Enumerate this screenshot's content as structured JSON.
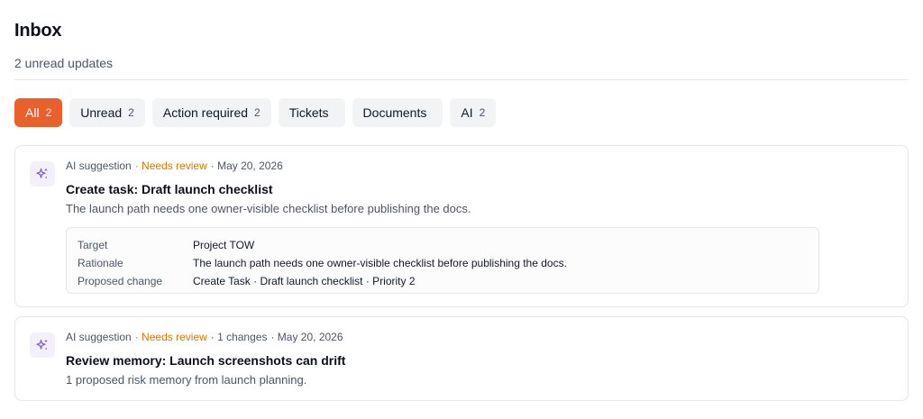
{
  "header": {
    "title": "Inbox",
    "subtitle": "2 unread updates"
  },
  "tabs": [
    {
      "label": "All",
      "count": "2",
      "active": true
    },
    {
      "label": "Unread",
      "count": "2"
    },
    {
      "label": "Action required",
      "count": "2"
    },
    {
      "label": "Tickets",
      "count": ""
    },
    {
      "label": "Documents",
      "count": ""
    },
    {
      "label": "AI",
      "count": "2"
    }
  ],
  "colors": {
    "accent": "#e8602c",
    "review": "#d97706",
    "ai_icon": "#7c5cd6"
  },
  "cards": [
    {
      "icon": "sparkles-icon",
      "source": "AI suggestion",
      "status": "· Needs review",
      "changes": "",
      "date": "· May 20, 2026",
      "title": "Create task: Draft launch checklist",
      "description": "The launch path needs one owner-visible checklist before publishing the docs.",
      "details": [
        {
          "key": "Target",
          "value": "Project TOW"
        },
        {
          "key": "Rationale",
          "value": "The launch path needs one owner-visible checklist before publishing the docs."
        },
        {
          "key": "Proposed change",
          "value": "Create Task · Draft launch checklist · Priority 2"
        }
      ]
    },
    {
      "icon": "sparkles-icon",
      "source": "AI suggestion",
      "status": "· Needs review",
      "changes": "· 1 changes",
      "date": "· May 20, 2026",
      "title": "Review memory: Launch screenshots can drift",
      "description": "1 proposed risk memory from launch planning."
    }
  ]
}
